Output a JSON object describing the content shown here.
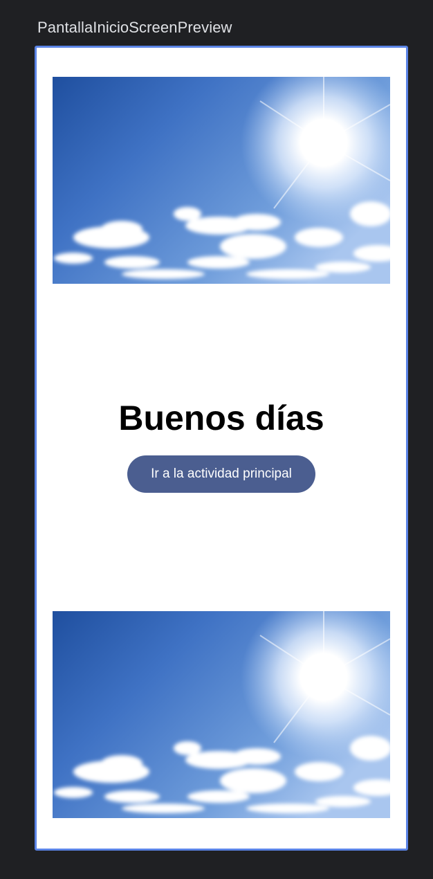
{
  "preview": {
    "title": "PantallaInicioScreenPreview"
  },
  "screen": {
    "greeting": "Buenos días",
    "button_label": "Ir a la actividad principal"
  },
  "images": [
    {
      "name": "sky-sun-image-top",
      "depicts": "sunny blue sky with clouds"
    },
    {
      "name": "sky-sun-image-bottom",
      "depicts": "sunny blue sky with clouds"
    }
  ],
  "colors": {
    "background": "#1f2023",
    "frame_border": "#5b84e6",
    "button": "#4b5e90",
    "button_text": "#ffffff",
    "sky_dark": "#1d4ea6",
    "sky_light": "#a9c6ef"
  }
}
